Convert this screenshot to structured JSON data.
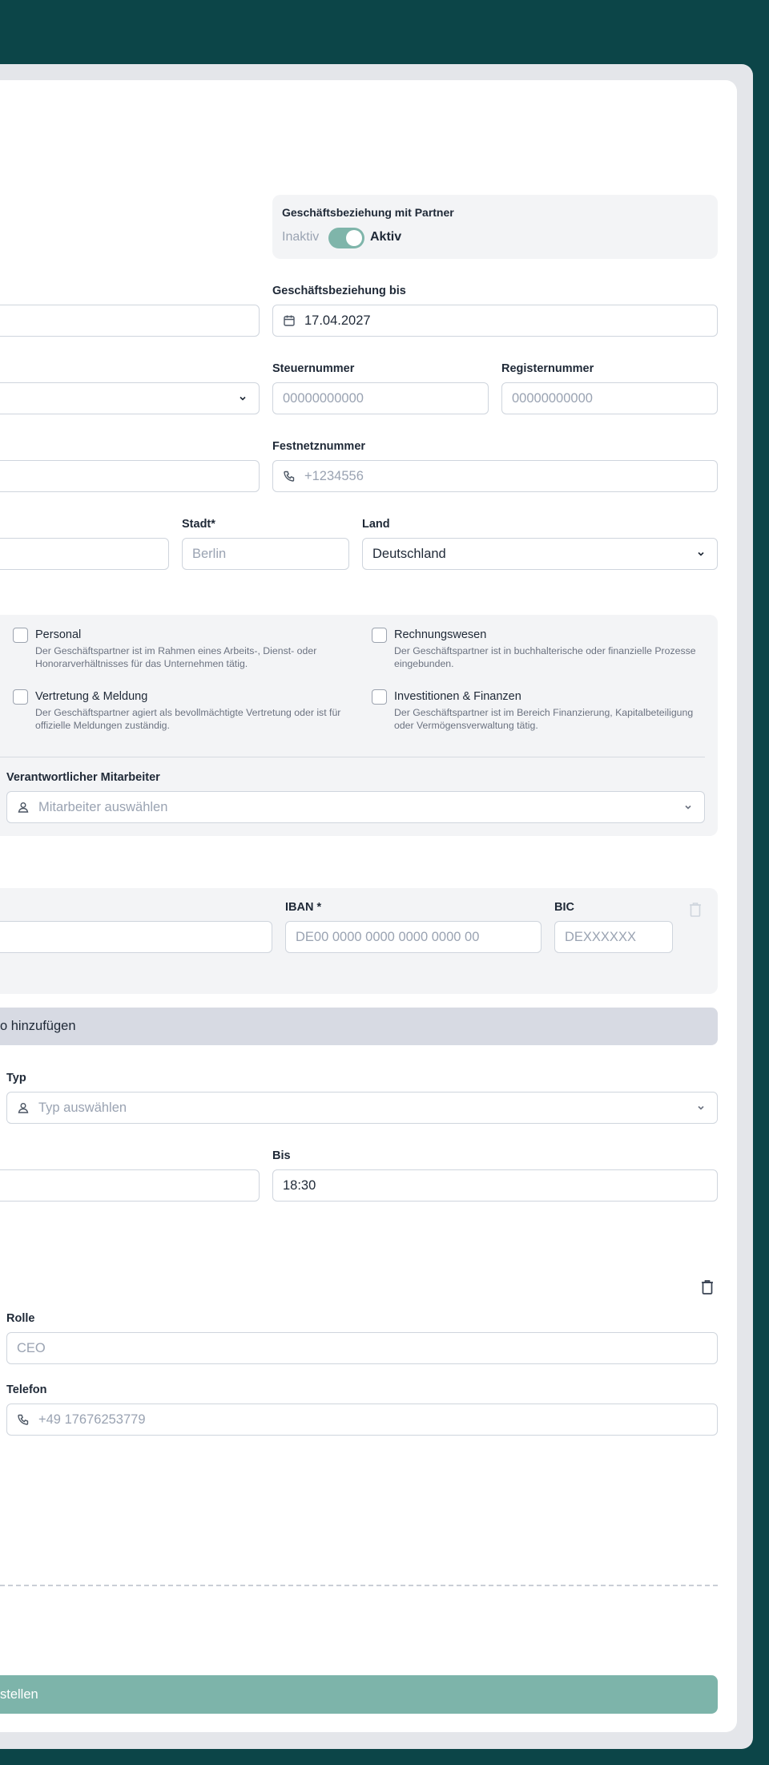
{
  "partner_status": {
    "title": "Geschäftsbeziehung mit Partner",
    "inactive_label": "Inaktiv",
    "active_label": "Aktiv",
    "is_active": true
  },
  "relationship_until": {
    "label": "Geschäftsbeziehung bis",
    "value": "17.04.2027"
  },
  "tax_number": {
    "label": "Steuernummer",
    "placeholder": "00000000000"
  },
  "register_number": {
    "label": "Registernummer",
    "placeholder": "00000000000"
  },
  "landline": {
    "label": "Festnetznummer",
    "placeholder": "+1234556"
  },
  "city": {
    "label": "Stadt*",
    "placeholder": "Berlin"
  },
  "country": {
    "label": "Land",
    "value": "Deutschland"
  },
  "areas": [
    {
      "title": "Personal",
      "description": "Der Geschäftspartner ist im Rahmen eines Arbeits-, Dienst- oder Honorarverhältnisses für das Unternehmen tätig.",
      "checked": false
    },
    {
      "title": "Rechnungswesen",
      "description": "Der Geschäftspartner ist in buchhalterische oder finanzielle Prozesse eingebunden.",
      "checked": false
    },
    {
      "title": "Vertretung & Meldung",
      "description": "Der Geschäftspartner agiert als bevollmächtigte Vertretung oder ist für offizielle Meldungen zuständig.",
      "checked": false
    },
    {
      "title": "Investitionen & Finanzen",
      "description": "Der Geschäftspartner ist im Bereich Finanzierung, Kapitalbeteiligung oder Vermögensverwaltung tätig.",
      "checked": false
    }
  ],
  "responsible_employee": {
    "label": "Verantwortlicher Mitarbeiter",
    "placeholder": "Mitarbeiter auswählen"
  },
  "bank": {
    "iban_label": "IBAN *",
    "iban_placeholder": "DE00 0000 0000 0000 0000 00",
    "bic_label": "BIC",
    "bic_placeholder": "DEXXXXXX"
  },
  "add_account_button": "o hinzufügen",
  "type": {
    "label": "Typ",
    "placeholder": "Typ auswählen"
  },
  "until_time": {
    "label": "Bis",
    "value": "18:30"
  },
  "contact": {
    "role_label": "Rolle",
    "role_placeholder": "CEO",
    "phone_label": "Telefon",
    "phone_placeholder": "+49 17676253779"
  },
  "submit_button": "stellen",
  "colors": {
    "background": "#0c4548",
    "accent": "#7db4aa",
    "panel": "#f3f4f6",
    "secondary_button": "#d7dae3"
  }
}
